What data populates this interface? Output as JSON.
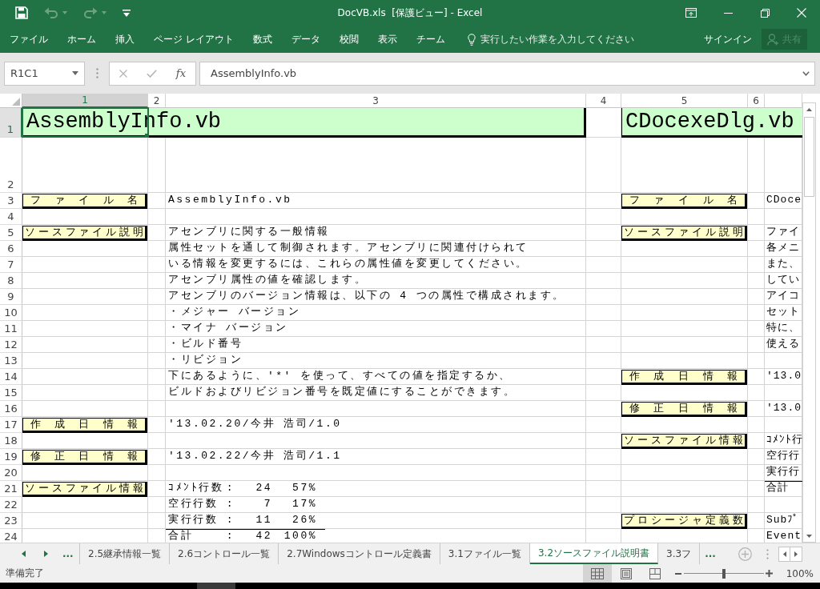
{
  "window": {
    "title": "DocVB.xls  [保護ビュー] - Excel"
  },
  "quick_access": [
    {
      "kind": "save",
      "disabled": false
    },
    {
      "kind": "undo",
      "disabled": true
    },
    {
      "kind": "redo",
      "disabled": true
    },
    {
      "kind": "customize",
      "disabled": false
    }
  ],
  "ribbon_tabs": [
    {
      "label": "ファイル",
      "selected": false
    },
    {
      "label": "ホーム",
      "selected": false
    },
    {
      "label": "挿入",
      "selected": false
    },
    {
      "label": "ページ レイアウト",
      "selected": false
    },
    {
      "label": "数式",
      "selected": false
    },
    {
      "label": "データ",
      "selected": false
    },
    {
      "label": "校閲",
      "selected": false
    },
    {
      "label": "表示",
      "selected": false
    },
    {
      "label": "チーム",
      "selected": false
    }
  ],
  "tell_me": {
    "placeholder": "実行したい作業を入力してください"
  },
  "account": {
    "sign_in": "サインイン",
    "share": {
      "label": "共有",
      "disabled": true
    }
  },
  "name_box": {
    "value": "R1C1"
  },
  "formula_bar": {
    "function_button": "fx",
    "value": "AssemblyInfo.vb"
  },
  "columns": [
    {
      "label": "1",
      "selected": true
    },
    {
      "label": "2",
      "selected": false
    },
    {
      "label": "3",
      "selected": false
    },
    {
      "label": "4",
      "selected": false
    },
    {
      "label": "5",
      "selected": false
    },
    {
      "label": "6",
      "selected": false
    },
    {
      "selected": false
    }
  ],
  "rows": [
    {
      "label": "1",
      "selected": true,
      "cells": {
        "column_1": {
          "kind": "title",
          "text": "AssemblyInfo.vb"
        },
        "column_5": {
          "kind": "title",
          "text": "CDocexeDlg.vb"
        }
      }
    },
    {
      "label": "2",
      "selected": false
    },
    {
      "label": "3",
      "selected": false,
      "cells": {
        "column_1": {
          "kind": "label",
          "text": "ファイル名"
        },
        "column_3": {
          "kind": "text",
          "text": "AssemblyInfo.vb"
        },
        "column_5": {
          "kind": "label",
          "text": "ファイル名"
        },
        "column_7": {
          "kind": "text",
          "text": "CDoce"
        }
      }
    },
    {
      "label": "4",
      "selected": false
    },
    {
      "label": "5",
      "selected": false,
      "cells": {
        "column_1": {
          "kind": "label",
          "text": "ソースファイル説明"
        },
        "column_3": {
          "kind": "text",
          "text": "アセンブリに関する一般情報"
        },
        "column_5": {
          "kind": "label",
          "text": "ソースファイル説明"
        },
        "column_7": {
          "kind": "text",
          "text": "ファイ"
        }
      }
    },
    {
      "label": "6",
      "selected": false,
      "cells": {
        "column_3": {
          "kind": "text",
          "text": "属性セットを通して制御されます。アセンブリに関連付けられて"
        },
        "column_7": {
          "kind": "text",
          "text": "各メニ"
        }
      }
    },
    {
      "label": "7",
      "selected": false,
      "cells": {
        "column_3": {
          "kind": "text",
          "text": "いる情報を変更するには、これらの属性値を変更してください。"
        },
        "column_7": {
          "kind": "text",
          "text": "また、"
        }
      }
    },
    {
      "label": "8",
      "selected": false,
      "cells": {
        "column_3": {
          "kind": "text",
          "text": "アセンブリ属性の値を確認します。"
        },
        "column_7": {
          "kind": "text",
          "text": "してい"
        }
      }
    },
    {
      "label": "9",
      "selected": false,
      "cells": {
        "column_3": {
          "kind": "text",
          "text": "アセンブリのバージョン情報は、以下の 4 つの属性で構成されます。"
        },
        "column_7": {
          "kind": "text",
          "text": "アイコ"
        }
      }
    },
    {
      "label": "10",
      "selected": false,
      "cells": {
        "column_3": {
          "kind": "text",
          "text": "・メジャー バージョン"
        },
        "column_7": {
          "kind": "text",
          "text": "セット"
        }
      }
    },
    {
      "label": "11",
      "selected": false,
      "cells": {
        "column_3": {
          "kind": "text",
          "text": "・マイナ バージョン"
        },
        "column_7": {
          "kind": "text",
          "text": "特に、"
        }
      }
    },
    {
      "label": "12",
      "selected": false,
      "cells": {
        "column_3": {
          "kind": "text",
          "text": "・ビルド番号"
        },
        "column_7": {
          "kind": "text",
          "text": "使える"
        }
      }
    },
    {
      "label": "13",
      "selected": false,
      "cells": {
        "column_3": {
          "kind": "text",
          "text": "・リビジョン"
        }
      }
    },
    {
      "label": "14",
      "selected": false,
      "cells": {
        "column_3": {
          "kind": "text",
          "text": "下にあるように、'*' を使って、すべての値を指定するか、"
        },
        "column_5": {
          "kind": "label",
          "text": "作成日情報"
        },
        "column_7": {
          "kind": "text",
          "text": "'13.0"
        }
      }
    },
    {
      "label": "15",
      "selected": false,
      "cells": {
        "column_3": {
          "kind": "text",
          "text": "ビルドおよびリビジョン番号を既定値にすることができます。"
        }
      }
    },
    {
      "label": "16",
      "selected": false,
      "cells": {
        "column_5": {
          "kind": "label",
          "text": "修正日情報"
        },
        "column_7": {
          "kind": "text",
          "text": "'13.0"
        }
      }
    },
    {
      "label": "17",
      "selected": false,
      "cells": {
        "column_1": {
          "kind": "label",
          "text": "作成日情報"
        },
        "column_3": {
          "kind": "text",
          "text": "'13.02.20/今井 浩司/1.0"
        }
      }
    },
    {
      "label": "18",
      "selected": false,
      "cells": {
        "column_5": {
          "kind": "label",
          "text": "ソースファイル情報"
        },
        "column_7": {
          "kind": "text",
          "text": "ｺﾒﾝﾄ行"
        }
      }
    },
    {
      "label": "19",
      "selected": false,
      "cells": {
        "column_1": {
          "kind": "label",
          "text": "修正日情報"
        },
        "column_3": {
          "kind": "text",
          "text": "'13.02.22/今井 浩司/1.1"
        },
        "column_7": {
          "kind": "text",
          "text": "空行行"
        }
      }
    },
    {
      "label": "20",
      "selected": false,
      "cells": {
        "column_7": {
          "kind": "text",
          "text": "実行行"
        }
      }
    },
    {
      "label": "21",
      "selected": false,
      "cells": {
        "column_1": {
          "kind": "label",
          "text": "ソースファイル情報"
        },
        "column_3": {
          "kind": "stat",
          "label": "ｺﾒﾝﾄ行数",
          "separator": ":",
          "count": "24",
          "percent": "57%"
        },
        "column_7": {
          "kind": "total",
          "text": "合計"
        }
      }
    },
    {
      "label": "22",
      "selected": false,
      "cells": {
        "column_3": {
          "kind": "stat",
          "label": "空行行数",
          "separator": ":",
          "count": "7",
          "percent": "17%"
        }
      }
    },
    {
      "label": "23",
      "selected": false,
      "cells": {
        "column_3": {
          "kind": "stat",
          "label": "実行行数",
          "separator": ":",
          "count": "11",
          "percent": "26%"
        },
        "column_5": {
          "kind": "label",
          "text": "プロシージャ定義数"
        },
        "column_7": {
          "kind": "text",
          "text": "Subﾌﾟ"
        }
      }
    },
    {
      "label": "24",
      "selected": false,
      "cells": {
        "column_3": {
          "kind": "total",
          "label": "合計",
          "separator": ":",
          "count": "42",
          "percent": "100%"
        },
        "column_7": {
          "kind": "text",
          "text": "Event"
        }
      }
    }
  ],
  "sheet_tabs": {
    "scroll_more": "...",
    "tabs": [
      {
        "label": "2.5継承情報一覧",
        "selected": false
      },
      {
        "label": "2.6コントロール一覧",
        "selected": false
      },
      {
        "label": "2.7Windowsコントロール定義書",
        "selected": false
      },
      {
        "label": "3.1ファイル一覧",
        "selected": false
      },
      {
        "label": "3.2ソースファイル説明書",
        "selected": true
      },
      {
        "label": "3.3フ",
        "selected": false
      }
    ],
    "more": "..."
  },
  "status_bar": {
    "text": "準備完了",
    "views": [
      {
        "kind": "normal",
        "selected": true
      },
      {
        "kind": "page_layout",
        "selected": false
      },
      {
        "kind": "page_break",
        "selected": false
      }
    ],
    "zoom": {
      "level": 0.5,
      "reading": "100%"
    }
  }
}
